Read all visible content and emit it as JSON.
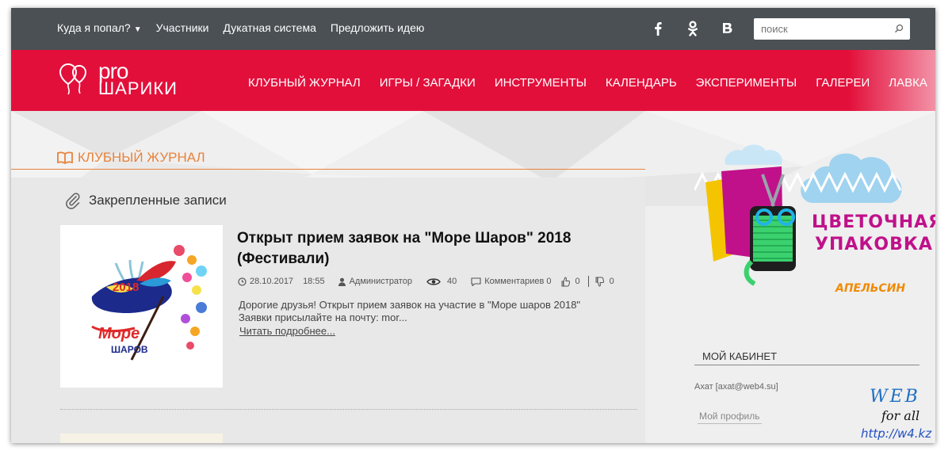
{
  "topbar": {
    "nav": [
      {
        "label": "Куда я попал?",
        "has_dropdown": true
      },
      {
        "label": "Участники"
      },
      {
        "label": "Дукатная система"
      },
      {
        "label": "Предложить идею"
      }
    ],
    "social": [
      "facebook-icon",
      "odnoklassniki-icon",
      "vk-icon"
    ],
    "search": {
      "placeholder": "поиск",
      "icon": "search-icon"
    }
  },
  "header": {
    "logo": {
      "line1": "pro",
      "line2": "ШАРИКИ"
    },
    "nav": [
      "КЛУБНЫЙ ЖУРНАЛ",
      "ИГРЫ / ЗАГАДКИ",
      "ИНСТРУМЕНТЫ",
      "КАЛЕНДАРЬ",
      "ЭКСПЕРИМЕНТЫ",
      "ГАЛЕРЕИ",
      "ЛАВКА"
    ],
    "bg_color": "#e30f3b"
  },
  "section": {
    "title": "КЛУБНЫЙ ЖУРНАЛ",
    "icon": "book-icon",
    "accent": "#e8833a"
  },
  "pinned": {
    "label": "Закрепленные записи",
    "icon": "paperclip-icon"
  },
  "post": {
    "title": "Открыт прием заявок на \"Море Шаров\" 2018 (Фестивали)",
    "thumb": {
      "year": "2018",
      "line1": "Море",
      "line2": "ШАРОВ"
    },
    "date": "28.10.2017",
    "time": "18:55",
    "author": "Администратор",
    "views": "40",
    "comments": "Комментариев 0",
    "likes": "0",
    "dislikes": "0",
    "excerpt": "Дорогие друзья! Открыт прием заявок на участие в \"Море шаров 2018\"  Заявки присылайте на почту: mor...",
    "read_more": "Читать подробнее..."
  },
  "sidebar": {
    "banner": {
      "line1": "ЦВЕТОЧНАЯ",
      "line2": "УПАКОВКА",
      "brand": "АПЕЛЬСИН"
    },
    "cabinet": {
      "title": "МОЙ КАБИНЕТ",
      "user": "Ахат [axat@web4.su]",
      "profile": "Мой профиль"
    }
  },
  "watermark": {
    "line1": "WEB",
    "line2": "for all",
    "url": "http://w4.kz"
  }
}
